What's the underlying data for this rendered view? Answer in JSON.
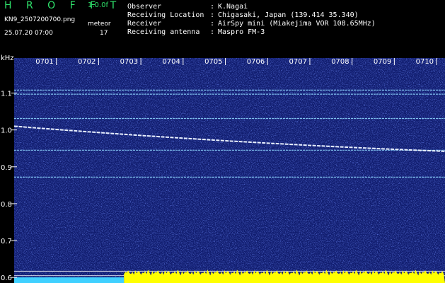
{
  "header": {
    "brand": "H R O F F T",
    "version": "1.0.0f",
    "filename": "KN9_2507200700.png",
    "meteor_label": "meteor",
    "datetime": "25.07.20 07:00",
    "meteor_count": "17",
    "info": [
      {
        "label": "Observer",
        "value": "K.Nagai"
      },
      {
        "label": "Receiving Location",
        "value": "Chigasaki, Japan (139.414 35.340)"
      },
      {
        "label": "Receiver",
        "value": "AirSpy mini (Miakejima VOR 108.65MHz)"
      },
      {
        "label": "Receiving antenna",
        "value": "Maspro FM-3"
      }
    ]
  },
  "colors": {
    "background": "#000000",
    "spectrogram": "#101c6e",
    "brand": "#2ee06a",
    "signal": "#e8f0ff",
    "noise_floor": "#ffff00",
    "noise_floor_left": "#3fd0ff"
  },
  "chart_data": {
    "type": "heatmap",
    "ylabel": "kHz",
    "x_ticks": [
      "0701",
      "0702",
      "0703",
      "0704",
      "0705",
      "0706",
      "0707",
      "0708",
      "0709",
      "0710"
    ],
    "y_ticks": [
      "1.1",
      "1.0",
      "0.9",
      "0.8",
      "0.7",
      "0.6"
    ],
    "y_tick_values": [
      1.1,
      1.0,
      0.9,
      0.8,
      0.7,
      0.6
    ],
    "ylim": [
      0.585,
      1.195
    ],
    "xlim": [
      0,
      10.2
    ],
    "horizontal_lines_khz": [
      1.108,
      1.097,
      1.031,
      0.945,
      0.872
    ],
    "sweep_line": {
      "start": [
        0.0,
        1.01
      ],
      "end": [
        10.2,
        0.942
      ]
    },
    "noise_floor_start_minute": 2.6
  }
}
